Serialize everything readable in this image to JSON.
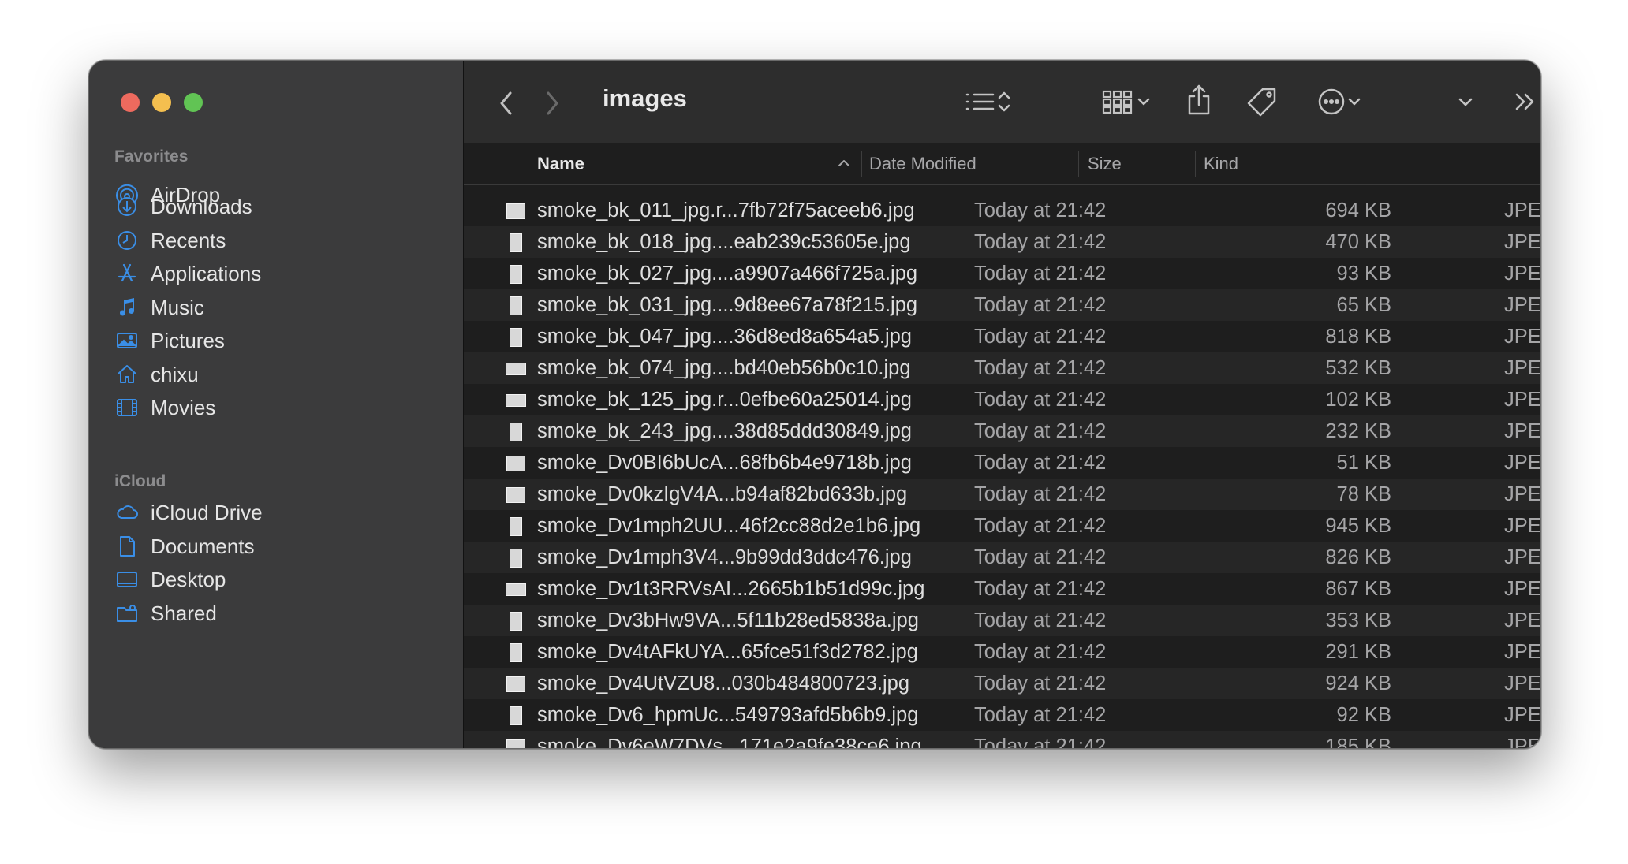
{
  "window": {
    "title": "images",
    "traffic_lights": {
      "close": "#ed6a5e",
      "minimize": "#f4bf4f",
      "zoom": "#61c454"
    }
  },
  "sidebar": {
    "sections": [
      {
        "label": "Favorites",
        "items": [
          {
            "label": "AirDrop",
            "icon": "airdrop-icon"
          },
          {
            "label": "Downloads",
            "icon": "downloads-icon"
          },
          {
            "label": "Recents",
            "icon": "clock-icon"
          },
          {
            "label": "Applications",
            "icon": "applications-icon"
          },
          {
            "label": "Music",
            "icon": "music-note-icon"
          },
          {
            "label": "Pictures",
            "icon": "photo-icon"
          },
          {
            "label": "chixu",
            "icon": "home-icon"
          },
          {
            "label": "Movies",
            "icon": "film-icon"
          }
        ]
      },
      {
        "label": "iCloud",
        "items": [
          {
            "label": "iCloud Drive",
            "icon": "cloud-icon"
          },
          {
            "label": "Documents",
            "icon": "document-icon"
          },
          {
            "label": "Desktop",
            "icon": "desktop-icon"
          },
          {
            "label": "Shared",
            "icon": "shared-folder-icon"
          }
        ]
      }
    ],
    "accent": "#3a8ee6"
  },
  "toolbar": {
    "icons": [
      "chevron-left-icon",
      "chevron-right-icon",
      "list-view-icon",
      "sort-arrows-icon",
      "grid-view-icon",
      "share-icon",
      "tag-icon",
      "more-actions-icon",
      "dropdown-chevron-icon",
      "double-chevron-icon",
      "search-icon"
    ]
  },
  "columns": {
    "name": "Name",
    "date": "Date Modified",
    "size": "Size",
    "kind": "Kind"
  },
  "files": [
    {
      "name": "smoke_bk_011_jpg.r...7fb72f75aceeb6.jpg",
      "date": "Today at 21:42",
      "size": "694 KB",
      "kind": "JPEG image",
      "thumb": "landscape"
    },
    {
      "name": "smoke_bk_018_jpg....eab239c53605e.jpg",
      "date": "Today at 21:42",
      "size": "470 KB",
      "kind": "JPEG image",
      "thumb": "portrait"
    },
    {
      "name": "smoke_bk_027_jpg....a9907a466f725a.jpg",
      "date": "Today at 21:42",
      "size": "93 KB",
      "kind": "JPEG image",
      "thumb": "portrait"
    },
    {
      "name": "smoke_bk_031_jpg....9d8ee67a78f215.jpg",
      "date": "Today at 21:42",
      "size": "65 KB",
      "kind": "JPEG image",
      "thumb": "portrait"
    },
    {
      "name": "smoke_bk_047_jpg....36d8ed8a654a5.jpg",
      "date": "Today at 21:42",
      "size": "818 KB",
      "kind": "JPEG image",
      "thumb": "portrait"
    },
    {
      "name": "smoke_bk_074_jpg....bd40eb56b0c10.jpg",
      "date": "Today at 21:42",
      "size": "532 KB",
      "kind": "JPEG image",
      "thumb": "wide"
    },
    {
      "name": "smoke_bk_125_jpg.r...0efbe60a25014.jpg",
      "date": "Today at 21:42",
      "size": "102 KB",
      "kind": "JPEG image",
      "thumb": "wide"
    },
    {
      "name": "smoke_bk_243_jpg....38d85ddd30849.jpg",
      "date": "Today at 21:42",
      "size": "232 KB",
      "kind": "JPEG image",
      "thumb": "portrait"
    },
    {
      "name": "smoke_Dv0BI6bUcA...68fb6b4e9718b.jpg",
      "date": "Today at 21:42",
      "size": "51 KB",
      "kind": "JPEG image",
      "thumb": "landscape"
    },
    {
      "name": "smoke_Dv0kzIgV4A...b94af82bd633b.jpg",
      "date": "Today at 21:42",
      "size": "78 KB",
      "kind": "JPEG image",
      "thumb": "landscape"
    },
    {
      "name": "smoke_Dv1mph2UU...46f2cc88d2e1b6.jpg",
      "date": "Today at 21:42",
      "size": "945 KB",
      "kind": "JPEG image",
      "thumb": "portrait"
    },
    {
      "name": "smoke_Dv1mph3V4...9b99dd3ddc476.jpg",
      "date": "Today at 21:42",
      "size": "826 KB",
      "kind": "JPEG image",
      "thumb": "portrait"
    },
    {
      "name": "smoke_Dv1t3RRVsAI...2665b1b51d99c.jpg",
      "date": "Today at 21:42",
      "size": "867 KB",
      "kind": "JPEG image",
      "thumb": "wide"
    },
    {
      "name": "smoke_Dv3bHw9VA...5f11b28ed5838a.jpg",
      "date": "Today at 21:42",
      "size": "353 KB",
      "kind": "JPEG image",
      "thumb": "portrait"
    },
    {
      "name": "smoke_Dv4tAFkUYA...65fce51f3d2782.jpg",
      "date": "Today at 21:42",
      "size": "291 KB",
      "kind": "JPEG image",
      "thumb": "portrait"
    },
    {
      "name": "smoke_Dv4UtVZU8...030b484800723.jpg",
      "date": "Today at 21:42",
      "size": "924 KB",
      "kind": "JPEG image",
      "thumb": "landscape"
    },
    {
      "name": "smoke_Dv6_hpmUc...549793afd5b6b9.jpg",
      "date": "Today at 21:42",
      "size": "92 KB",
      "kind": "JPEG image",
      "thumb": "portrait"
    },
    {
      "name": "smoke_Dv6eW7DVs...171e2a9fe38ce6.jpg",
      "date": "Today at 21:42",
      "size": "185 KB",
      "kind": "JPEG image",
      "thumb": "landscape"
    }
  ]
}
